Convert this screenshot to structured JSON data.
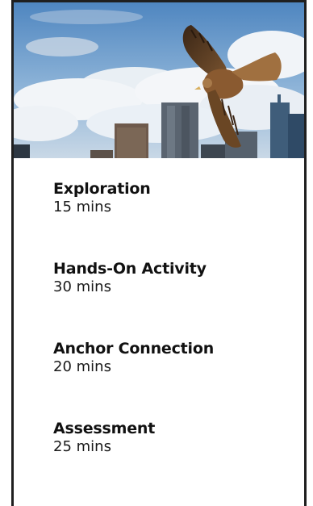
{
  "hero": {
    "image": "kite-bird-over-city-skyline"
  },
  "activities": [
    {
      "title": "Exploration",
      "duration": "15 mins"
    },
    {
      "title": "Hands-On Activity",
      "duration": "30 mins"
    },
    {
      "title": "Anchor Connection",
      "duration": "20 mins"
    },
    {
      "title": "Assessment",
      "duration": "25 mins"
    }
  ]
}
